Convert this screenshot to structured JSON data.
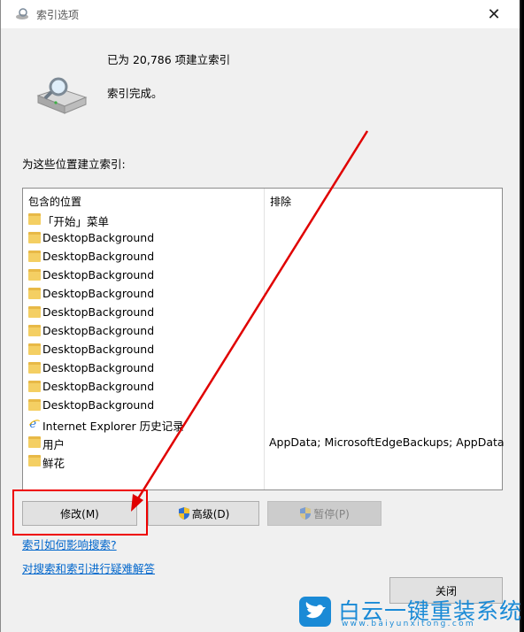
{
  "window": {
    "title": "索引选项",
    "close_glyph": "✕"
  },
  "header": {
    "count_text": "已为 20,786 项建立索引",
    "status_text": "索引完成。"
  },
  "locations": {
    "label": "为这些位置建立索引:",
    "columns": {
      "included": "包含的位置",
      "excluded": "排除"
    },
    "rows": [
      {
        "name": "「开始」菜单",
        "icon": "folder-icon",
        "exclude": ""
      },
      {
        "name": "DesktopBackground",
        "icon": "folder-icon",
        "exclude": ""
      },
      {
        "name": "DesktopBackground",
        "icon": "folder-icon",
        "exclude": ""
      },
      {
        "name": "DesktopBackground",
        "icon": "folder-icon",
        "exclude": ""
      },
      {
        "name": "DesktopBackground",
        "icon": "folder-icon",
        "exclude": ""
      },
      {
        "name": "DesktopBackground",
        "icon": "folder-icon",
        "exclude": ""
      },
      {
        "name": "DesktopBackground",
        "icon": "folder-icon",
        "exclude": ""
      },
      {
        "name": "DesktopBackground",
        "icon": "folder-icon",
        "exclude": ""
      },
      {
        "name": "DesktopBackground",
        "icon": "folder-icon",
        "exclude": ""
      },
      {
        "name": "DesktopBackground",
        "icon": "folder-icon",
        "exclude": ""
      },
      {
        "name": "DesktopBackground",
        "icon": "folder-icon",
        "exclude": ""
      },
      {
        "name": "Internet Explorer 历史记录",
        "icon": "internet-explorer-icon",
        "exclude": ""
      },
      {
        "name": "用户",
        "icon": "folder-icon",
        "exclude": "AppData; MicrosoftEdgeBackups; AppData"
      },
      {
        "name": "鲜花",
        "icon": "folder-icon",
        "exclude": ""
      }
    ]
  },
  "buttons": {
    "modify": "修改(M)",
    "advanced": "高级(D)",
    "pause": "暂停(P)",
    "close": "关闭"
  },
  "links": {
    "how_affects": "索引如何影响搜索?",
    "troubleshoot": "对搜索和索引进行疑难解答"
  },
  "watermark": {
    "name": "白云一键重装系统",
    "url": "www.baiyunxitong.com"
  },
  "colors": {
    "annotation_red": "#e00000",
    "link_blue": "#0066cc",
    "watermark_blue": "#1a8ad6"
  }
}
